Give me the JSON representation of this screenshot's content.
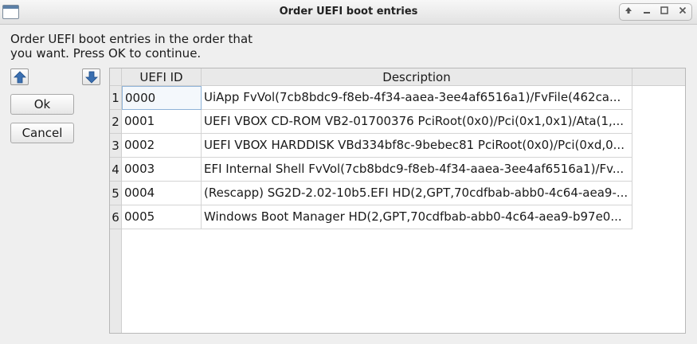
{
  "window": {
    "title": "Order UEFI boot entries",
    "controls": [
      "up-icon",
      "minimize-icon",
      "maximize-icon",
      "close-icon"
    ]
  },
  "instructions": "Order UEFI boot entries in the order that you want. Press OK to continue.",
  "buttons": {
    "move_up_icon": "arrow-up-icon",
    "move_down_icon": "arrow-down-icon",
    "ok_label": "Ok",
    "cancel_label": "Cancel"
  },
  "table": {
    "columns": [
      "UEFI ID",
      "Description"
    ],
    "rows": [
      {
        "num": "1",
        "id": "0000",
        "desc": "UiApp FvVol(7cb8bdc9-f8eb-4f34-aaea-3ee4af6516a1)/FvFile(462ca..."
      },
      {
        "num": "2",
        "id": "0001",
        "desc": "UEFI VBOX CD-ROM VB2-01700376 PciRoot(0x0)/Pci(0x1,0x1)/Ata(1,..."
      },
      {
        "num": "3",
        "id": "0002",
        "desc": "UEFI VBOX HARDDISK VBd334bf8c-9bebec81 PciRoot(0x0)/Pci(0xd,0..."
      },
      {
        "num": "4",
        "id": "0003",
        "desc": "EFI Internal Shell FvVol(7cb8bdc9-f8eb-4f34-aaea-3ee4af6516a1)/Fv..."
      },
      {
        "num": "5",
        "id": "0004",
        "desc": "(Rescapp) SG2D-2.02-10b5.EFI HD(2,GPT,70cdfbab-abb0-4c64-aea9-..."
      },
      {
        "num": "6",
        "id": "0005",
        "desc": "Windows Boot Manager HD(2,GPT,70cdfbab-abb0-4c64-aea9-b97e0..."
      }
    ],
    "selected_row": 0
  },
  "colors": {
    "selection_border": "#8fb3d8",
    "arrow_blue": "#3b6fb0"
  }
}
